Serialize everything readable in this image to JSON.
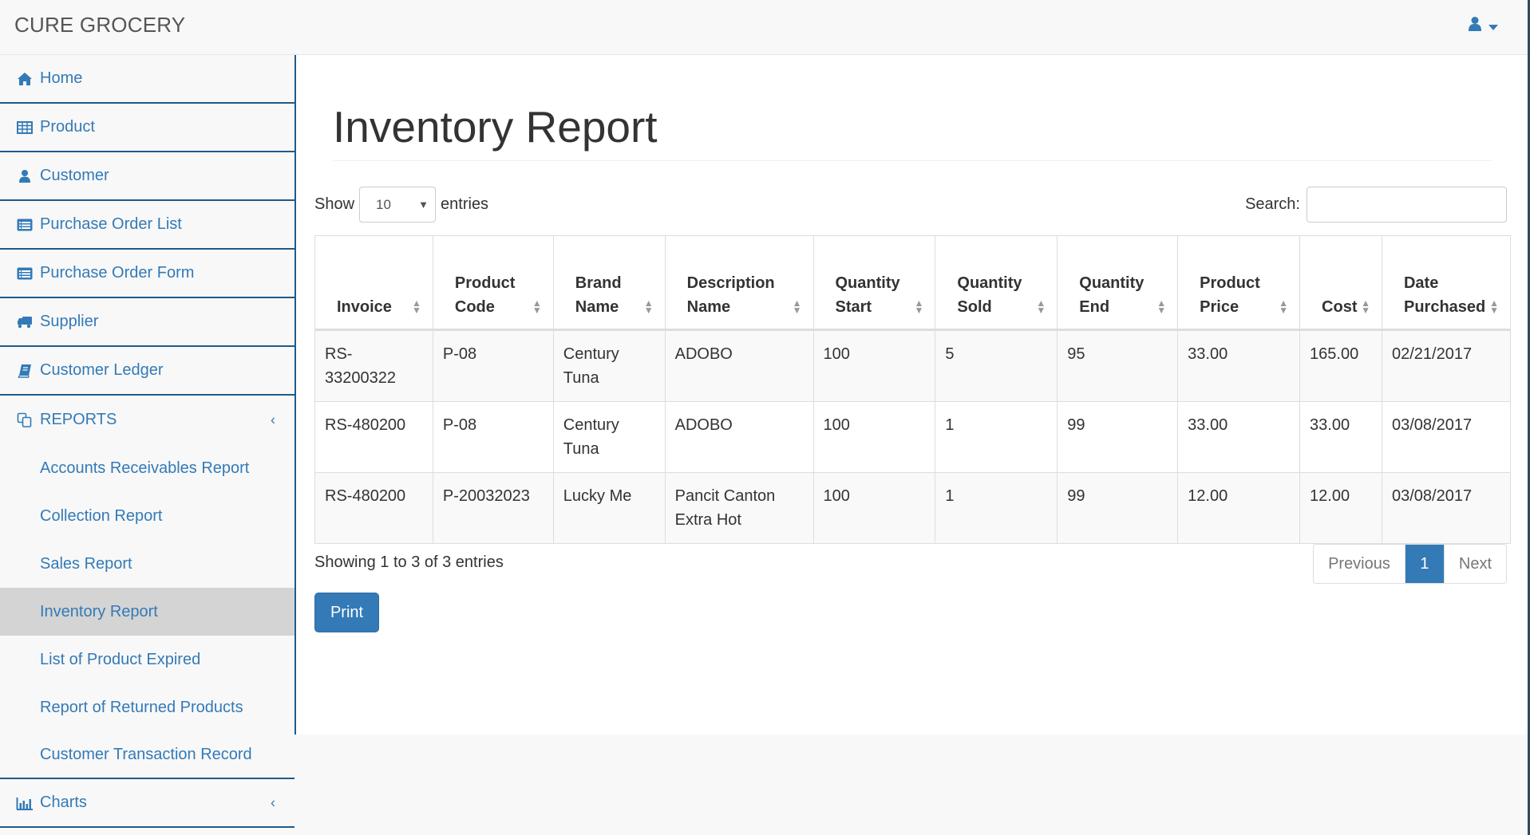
{
  "app": {
    "brand": "CURE GROCERY",
    "accent_color": "#337ab7",
    "user_menu": {
      "icon": "user-icon",
      "caret": "caret-down-icon"
    }
  },
  "sidebar": {
    "items": [
      {
        "label": "Home",
        "icon": "home-icon"
      },
      {
        "label": "Product",
        "icon": "table-icon"
      },
      {
        "label": "Customer",
        "icon": "user-icon"
      },
      {
        "label": "Purchase Order List",
        "icon": "list-alt-icon"
      },
      {
        "label": "Purchase Order Form",
        "icon": "list-alt-icon"
      },
      {
        "label": "Supplier",
        "icon": "truck-icon"
      },
      {
        "label": "Customer Ledger",
        "icon": "book-icon"
      }
    ],
    "reports": {
      "label": "REPORTS",
      "icon": "copy-icon",
      "chevron": "‹",
      "children": [
        {
          "label": "Accounts Receivables Report"
        },
        {
          "label": "Collection Report"
        },
        {
          "label": "Sales Report"
        },
        {
          "label": "Inventory Report",
          "active": true
        },
        {
          "label": "List of Product Expired"
        },
        {
          "label": "Report of Returned Products"
        },
        {
          "label": "Customer Transaction Record"
        }
      ]
    },
    "charts": {
      "label": "Charts",
      "icon": "bar-chart-icon",
      "chevron": "‹"
    }
  },
  "main": {
    "title": "Inventory Report",
    "length": {
      "show_label": "Show",
      "value": "10",
      "entries_label": "entries"
    },
    "search": {
      "label": "Search:",
      "value": "",
      "placeholder": ""
    },
    "table": {
      "columns": [
        {
          "line1": "",
          "line2": "Invoice"
        },
        {
          "line1": "Product",
          "line2": "Code"
        },
        {
          "line1": "Brand",
          "line2": "Name"
        },
        {
          "line1": "Description",
          "line2": "Name"
        },
        {
          "line1": "Quantity",
          "line2": "Start"
        },
        {
          "line1": "Quantity",
          "line2": "Sold"
        },
        {
          "line1": "Quantity",
          "line2": "End"
        },
        {
          "line1": "Product",
          "line2": "Price"
        },
        {
          "line1": "",
          "line2": "Cost"
        },
        {
          "line1": "Date",
          "line2": "Purchased"
        }
      ],
      "rows": [
        [
          "RS-33200322",
          "P-08",
          "Century Tuna",
          "ADOBO",
          "100",
          "5",
          "95",
          "33.00",
          "165.00",
          "02/21/2017"
        ],
        [
          "RS-480200",
          "P-08",
          "Century Tuna",
          "ADOBO",
          "100",
          "1",
          "99",
          "33.00",
          "33.00",
          "03/08/2017"
        ],
        [
          "RS-480200",
          "P-20032023",
          "Lucky Me",
          "Pancit Canton Extra Hot",
          "100",
          "1",
          "99",
          "12.00",
          "12.00",
          "03/08/2017"
        ]
      ]
    },
    "info": "Showing 1 to 3 of 3 entries",
    "pagination": {
      "previous": "Previous",
      "current": "1",
      "next": "Next"
    },
    "print_label": "Print"
  }
}
